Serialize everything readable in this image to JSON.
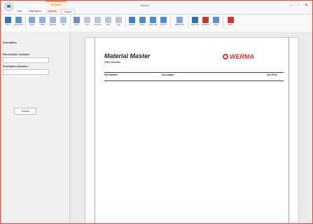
{
  "titlebar": {
    "title": "Werma",
    "context_label": "Finance",
    "window_controls": [
      "–",
      "▫",
      "✕"
    ]
  },
  "tabs": [
    "File",
    "View Menu",
    "Options",
    "Export"
  ],
  "ribbon": {
    "buttons": [
      {
        "label": "Print",
        "icon": "printer-icon",
        "color": "#2f6fb6"
      },
      {
        "label": "Quick Print",
        "icon": "quick-print-icon",
        "color": "#5b8fd0"
      },
      {
        "label": "Setup",
        "icon": "page-setup-icon",
        "color": "#7da5d8"
      },
      {
        "label": "Scale",
        "icon": "scale-icon",
        "color": "#8fb0dc"
      },
      {
        "label": "Margins",
        "icon": "margins-icon",
        "color": "#9db8dd"
      },
      {
        "label": "Size",
        "icon": "size-icon",
        "color": "#a8c0e0"
      },
      {
        "label": "Find",
        "icon": "binoculars-icon",
        "color": "#6a8fbf"
      },
      {
        "label": "First",
        "icon": "first-page-icon",
        "color": "#b9c6d9"
      },
      {
        "label": "Previous",
        "icon": "previous-page-icon",
        "color": "#b9c6d9"
      },
      {
        "label": "Next",
        "icon": "next-page-icon",
        "color": "#b9c6d9"
      },
      {
        "label": "Last",
        "icon": "last-page-icon",
        "color": "#b9c6d9"
      },
      {
        "label": "Pointer",
        "icon": "pointer-icon",
        "color": "#3f7bc6"
      },
      {
        "label": "Zoom",
        "icon": "zoom-icon",
        "color": "#4f8ad0"
      },
      {
        "label": "Zoom Out",
        "icon": "zoom-out-icon",
        "color": "#4f8ad0"
      },
      {
        "label": "Zoom In",
        "icon": "zoom-in-icon",
        "color": "#4f8ad0"
      },
      {
        "label": "Watermark",
        "icon": "watermark-icon",
        "color": "#7da5d8"
      },
      {
        "label": "Export To",
        "icon": "export-icon",
        "color": "#2f6fb6"
      },
      {
        "label": "E-Mail As",
        "icon": "email-icon",
        "color": "#c0392b"
      },
      {
        "label": "Open",
        "icon": "open-icon",
        "color": "#5b8fd0"
      },
      {
        "label": "Close",
        "icon": "close-preview-icon",
        "color": "#d9342b"
      }
    ],
    "groups": [
      "Print",
      "Page Setup",
      "Navigation",
      "Zoom",
      "Background",
      "Export",
      "Close"
    ]
  },
  "sidebar": {
    "description_title": "Description",
    "fields": [
      {
        "label": "Part Number includes:",
        "value": ""
      },
      {
        "label": "Description includes:",
        "value": ""
      }
    ],
    "print_button": "Submit"
  },
  "report": {
    "title": "Material Master",
    "filter_label": "Filter selection:",
    "filter_value": "",
    "logo_text": "WERMA",
    "columns": [
      "Part Number",
      "Description",
      "Unit Price"
    ],
    "rows": [
      [
        "",
        "",
        ""
      ],
      [
        "",
        "",
        ""
      ],
      [
        "",
        "",
        ""
      ]
    ]
  }
}
